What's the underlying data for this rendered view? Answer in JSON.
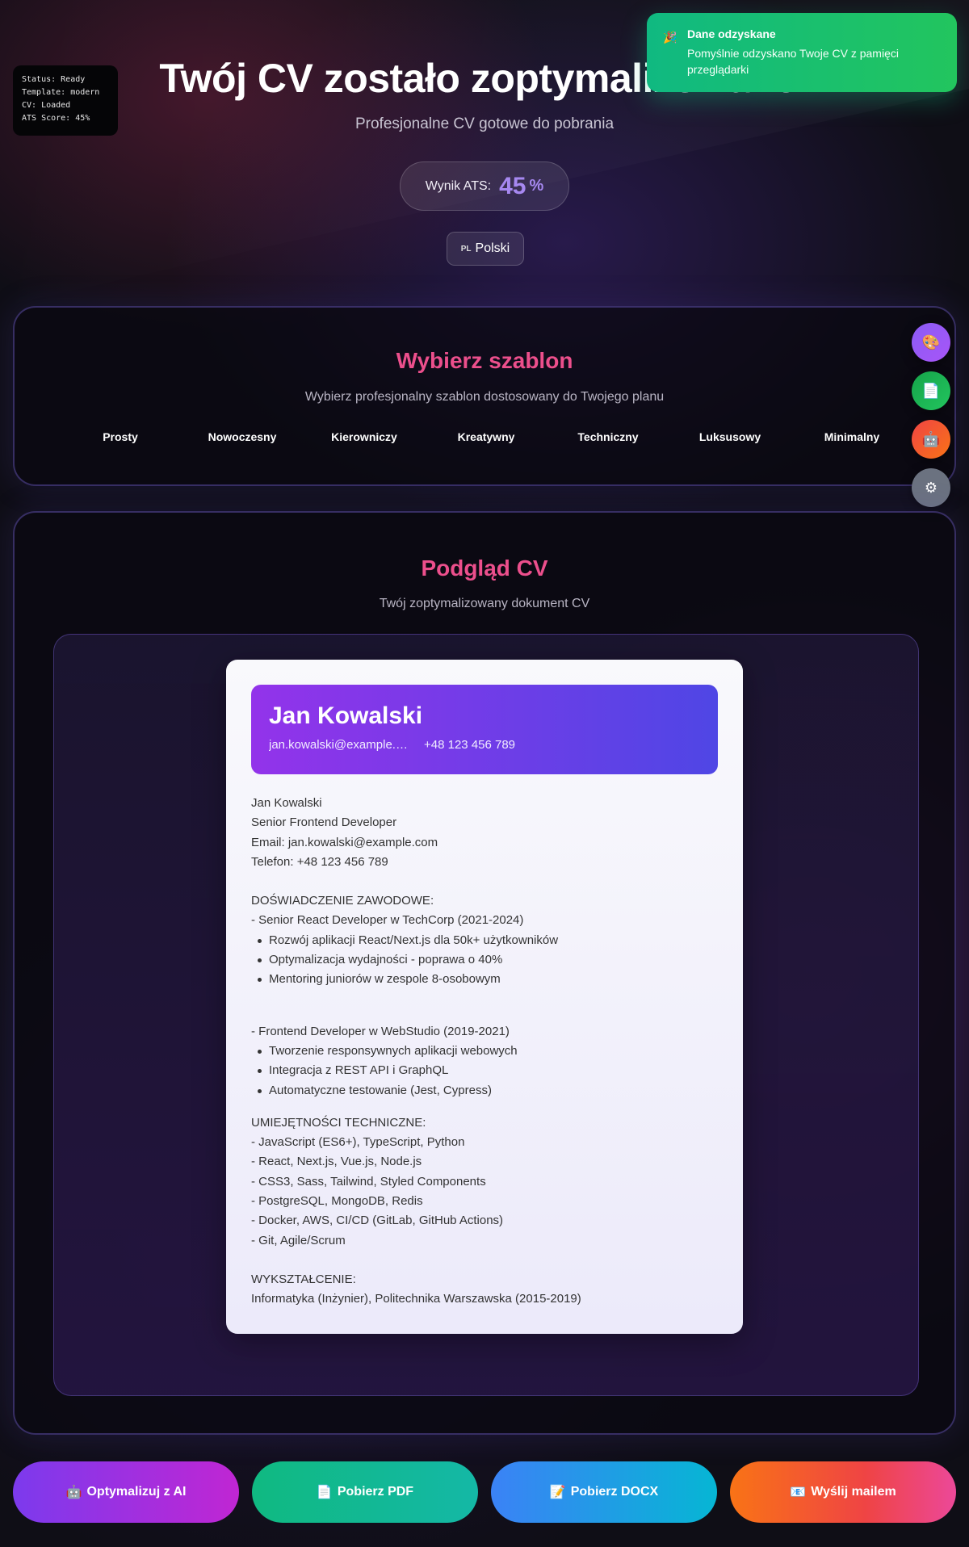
{
  "debug": {
    "status": "Status: Ready",
    "template": "Template: modern",
    "cv": "CV: Loaded",
    "ats": "ATS Score: 45%"
  },
  "header": {
    "title": "Twój CV zostało zoptymalizowane!",
    "subtitle": "Profesjonalne CV gotowe do pobrania",
    "ats_label": "Wynik ATS:",
    "ats_value": "45",
    "ats_unit": "%",
    "language_flag": "PL",
    "language": "Polski"
  },
  "toast": {
    "title": "Dane odzyskane",
    "message": "Pomyślnie odzyskano Twoje CV z pamięci przeglądarki",
    "icon": "party-icon"
  },
  "templates": {
    "title": "Wybierz szablon",
    "subtitle": "Wybierz profesjonalny szablon dostosowany do Twojego planu",
    "items": [
      "Prosty",
      "Nowoczesny",
      "Kierowniczy",
      "Kreatywny",
      "Techniczny",
      "Luksusowy",
      "Minimalny"
    ]
  },
  "side_buttons": [
    {
      "icon": "palette-icon",
      "glyph": "🎨"
    },
    {
      "icon": "document-icon",
      "glyph": "📄"
    },
    {
      "icon": "robot-icon",
      "glyph": "🤖"
    },
    {
      "icon": "gear-icon",
      "glyph": "⚙"
    }
  ],
  "preview": {
    "title": "Podgląd CV",
    "subtitle": "Twój zoptymalizowany dokument CV"
  },
  "cv": {
    "name": "Jan Kowalski",
    "email": "jan.kowalski@example.com",
    "phone": "+48 123 456 789",
    "lines": {
      "l1": "Jan Kowalski",
      "l2": "Senior Frontend Developer",
      "l3": "Email: jan.kowalski@example.com",
      "l4": "Telefon: +48 123 456 789",
      "exp_heading": "DOŚWIADCZENIE ZAWODOWE:",
      "job1": "- Senior React Developer w TechCorp (2021-2024)",
      "job1_b1": "Rozwój aplikacji React/Next.js dla 50k+ użytkowników",
      "job1_b2": "Optymalizacja wydajności - poprawa o 40%",
      "job1_b3": "Mentoring juniorów w zespole 8-osobowym",
      "job2": "- Frontend Developer w WebStudio (2019-2021)",
      "job2_b1": "Tworzenie responsywnych aplikacji webowych",
      "job2_b2": "Integracja z REST API i GraphQL",
      "job2_b3": "Automatyczne testowanie (Jest, Cypress)",
      "skills_heading": "UMIEJĘTNOŚCI TECHNICZNE:",
      "s1": "- JavaScript (ES6+), TypeScript, Python",
      "s2": "- React, Next.js, Vue.js, Node.js",
      "s3": "- CSS3, Sass, Tailwind, Styled Components",
      "s4": "- PostgreSQL, MongoDB, Redis",
      "s5": "- Docker, AWS, CI/CD (GitLab, GitHub Actions)",
      "s6": "- Git, Agile/Scrum",
      "edu_heading": "WYKSZTAŁCENIE:",
      "edu1": "Informatyka (Inżynier), Politechnika Warszawska (2015-2019)"
    }
  },
  "actions": {
    "optimize": {
      "glyph": "🤖",
      "label": "Optymalizuj z AI"
    },
    "pdf": {
      "glyph": "📄",
      "label": "Pobierz PDF"
    },
    "docx": {
      "glyph": "📝",
      "label": "Pobierz DOCX"
    },
    "mail": {
      "glyph": "📧",
      "label": "Wyślij mailem"
    }
  },
  "colors": {
    "accent_pink": "#ec4f8c",
    "ats_purple": "#a688f0",
    "toast_green": "#10b981"
  }
}
